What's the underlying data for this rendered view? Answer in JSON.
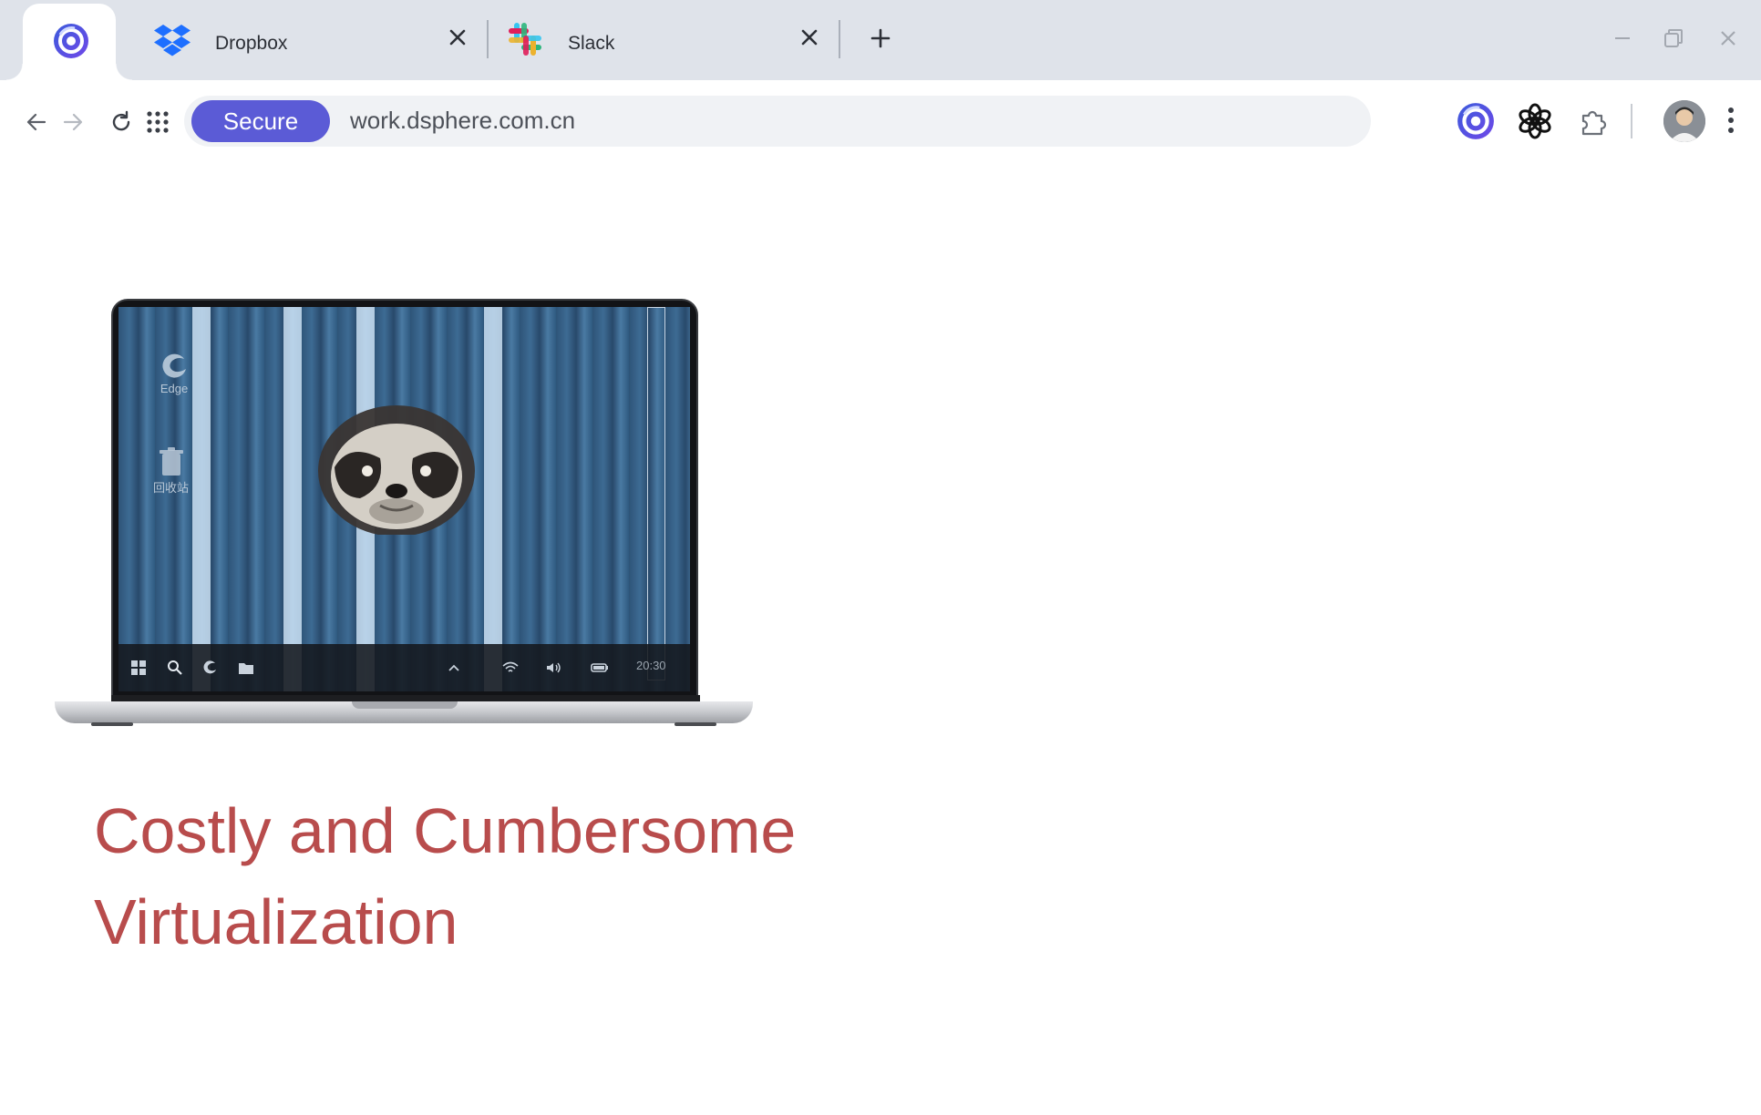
{
  "tabs": [
    {
      "label": "",
      "icon": "dsphere-icon"
    },
    {
      "label": "Dropbox",
      "icon": "dropbox-icon"
    },
    {
      "label": "Slack",
      "icon": "slack-icon"
    }
  ],
  "address_bar": {
    "security_label": "Secure",
    "url": "work.dsphere.com.cn"
  },
  "extensions": [
    "dsphere-icon",
    "openai-icon",
    "puzzle-icon"
  ],
  "laptop_screen": {
    "desktop_icons": [
      {
        "label": "Edge",
        "icon": "edge-icon"
      },
      {
        "label": "回收站",
        "icon": "recycle-bin-icon"
      }
    ],
    "clock": "20:30"
  },
  "hero": {
    "heading": "Costly and Cumbersome Virtualization"
  },
  "colors": {
    "brand_accent": "#5b5bd6",
    "heading": "#b84c4c",
    "tab_strip": "#dfe3ea"
  }
}
